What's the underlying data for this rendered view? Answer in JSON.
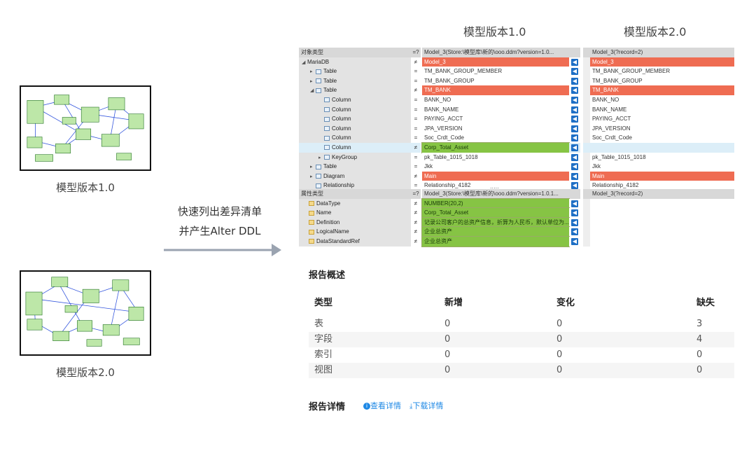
{
  "thumbs": {
    "v1_caption": "模型版本1.0",
    "v2_caption": "模型版本2.0"
  },
  "middle": {
    "line1": "快速列出差异清单",
    "line2": "并产生Alter DDL"
  },
  "column_headers": {
    "v1": "模型版本1.0",
    "v2": "模型版本2.0"
  },
  "object_grid": {
    "header": {
      "type": "对象类型",
      "op": "=?",
      "left": "Model_3(Store:\\模型库\\新的\\ooo.ddm?version=1.0...",
      "right": "Model_3(?record=2)"
    },
    "rows": [
      {
        "indent": 0,
        "tri": "◢",
        "icon": false,
        "name": "MariaDB",
        "op": "≠",
        "left": "Model_3",
        "right": "Model_3",
        "hl": "red"
      },
      {
        "indent": 1,
        "tri": "▸",
        "icon": true,
        "name": "Table",
        "op": "=",
        "left": "TM_BANK_GROUP_MEMBER",
        "right": "TM_BANK_GROUP_MEMBER",
        "hl": ""
      },
      {
        "indent": 1,
        "tri": "▸",
        "icon": true,
        "name": "Table",
        "op": "=",
        "left": "TM_BANK_GROUP",
        "right": "TM_BANK_GROUP",
        "hl": ""
      },
      {
        "indent": 1,
        "tri": "◢",
        "icon": true,
        "name": "Table",
        "op": "≠",
        "left": "TM_BANK",
        "right": "TM_BANK",
        "hl": "red"
      },
      {
        "indent": 2,
        "tri": "",
        "icon": true,
        "name": "Column",
        "op": "=",
        "left": "BANK_NO",
        "right": "BANK_NO",
        "hl": ""
      },
      {
        "indent": 2,
        "tri": "",
        "icon": true,
        "name": "Column",
        "op": "=",
        "left": "BANK_NAME",
        "right": "BANK_NAME",
        "hl": ""
      },
      {
        "indent": 2,
        "tri": "",
        "icon": true,
        "name": "Column",
        "op": "=",
        "left": "PAYING_ACCT",
        "right": "PAYING_ACCT",
        "hl": ""
      },
      {
        "indent": 2,
        "tri": "",
        "icon": true,
        "name": "Column",
        "op": "=",
        "left": "JPA_VERSION",
        "right": "JPA_VERSION",
        "hl": ""
      },
      {
        "indent": 2,
        "tri": "",
        "icon": true,
        "name": "Column",
        "op": "=",
        "left": "Soc_Crdt_Code",
        "right": "Soc_Crdt_Code",
        "hl": ""
      },
      {
        "indent": 2,
        "tri": "",
        "icon": true,
        "name": "Column",
        "op": "≠",
        "left": "Corp_Total_Asset",
        "right": "",
        "hl": "green",
        "selected": true
      },
      {
        "indent": 2,
        "tri": "▸",
        "icon": true,
        "name": "KeyGroup",
        "op": "=",
        "left": "pk_Table_1015_1018",
        "right": "pk_Table_1015_1018",
        "hl": ""
      },
      {
        "indent": 1,
        "tri": "▸",
        "icon": true,
        "name": "Table",
        "op": "=",
        "left": "Jkk",
        "right": "Jkk",
        "hl": ""
      },
      {
        "indent": 1,
        "tri": "▸",
        "icon": true,
        "name": "Diagram",
        "op": "≠",
        "left": "Main",
        "right": "Main",
        "hl": "red"
      },
      {
        "indent": 1,
        "tri": "",
        "icon": true,
        "name": "Relationship",
        "op": "=",
        "left": "Relationship_4182",
        "right": "Relationship_4182",
        "hl": ""
      }
    ],
    "splitter": "....."
  },
  "attr_grid": {
    "header": {
      "type": "属性类型",
      "op": "=?",
      "left": "Model_3(Store:\\模型库\\新的\\ooo.ddm?version=1.0.1...",
      "right": "Model_3(?record=2)"
    },
    "rows": [
      {
        "name": "DataType",
        "op": "≠",
        "left": "NUMBER(20,2)",
        "right": ""
      },
      {
        "name": "Name",
        "op": "≠",
        "left": "Corp_Total_Asset",
        "right": ""
      },
      {
        "name": "Definition",
        "op": "≠",
        "left": "记录公司客户的总资产信息，折算为人民币，默认单位为...",
        "right": ""
      },
      {
        "name": "LogicalName",
        "op": "≠",
        "left": "企业总资产",
        "right": ""
      },
      {
        "name": "DataStandardRef",
        "op": "≠",
        "left": "企业总资产",
        "right": ""
      }
    ]
  },
  "report": {
    "overview_title": "报告概述",
    "headers": [
      "类型",
      "新增",
      "变化",
      "缺失"
    ],
    "rows": [
      [
        "表",
        "0",
        "0",
        "3"
      ],
      [
        "字段",
        "0",
        "0",
        "4"
      ],
      [
        "索引",
        "0",
        "0",
        "0"
      ],
      [
        "视图",
        "0",
        "0",
        "0"
      ]
    ],
    "detail_title": "报告详情",
    "view_link": "查看详情",
    "download_link": "下载详情"
  },
  "colors": {
    "diff_red": "#ef6c52",
    "diff_green": "#86c444",
    "arrow_blue": "#1e6fc5",
    "link_blue": "#1e88e5"
  }
}
